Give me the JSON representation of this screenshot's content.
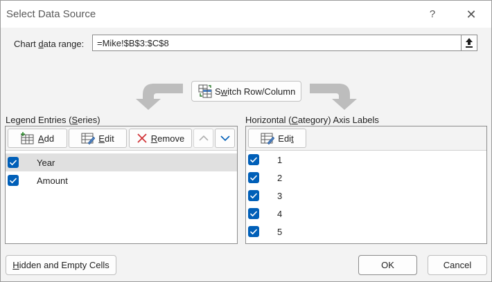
{
  "window": {
    "title": "Select Data Source",
    "help_glyph": "?",
    "close_glyph": "✕"
  },
  "range": {
    "label_pre": "Chart ",
    "label_key": "d",
    "label_post": "ata range:",
    "value": "=Mike!$B$3:$C$8"
  },
  "switch_button": {
    "label_pre": "S",
    "label_key": "w",
    "label_post": "itch Row/Column"
  },
  "legend": {
    "label_pre": "Legend Entries (",
    "label_key": "S",
    "label_post": "eries)",
    "add_key": "A",
    "add_rest": "dd",
    "edit_key": "E",
    "edit_rest": "dit",
    "remove_key": "R",
    "remove_rest": "emove",
    "items": [
      {
        "label": "Year",
        "checked": true,
        "selected": true
      },
      {
        "label": "Amount",
        "checked": true,
        "selected": false
      }
    ]
  },
  "axis": {
    "label_pre": "Horizontal (",
    "label_key": "C",
    "label_post": "ategory) Axis Labels",
    "edit_pre": "Edi",
    "edit_key": "t",
    "items": [
      {
        "label": "1",
        "checked": true
      },
      {
        "label": "2",
        "checked": true
      },
      {
        "label": "3",
        "checked": true
      },
      {
        "label": "4",
        "checked": true
      },
      {
        "label": "5",
        "checked": true
      }
    ]
  },
  "footer": {
    "hidden_key": "H",
    "hidden_rest": "idden and Empty Cells",
    "ok_label": "OK",
    "cancel_label": "Cancel"
  },
  "colors": {
    "accent": "#005fb8",
    "selected_row": "#e0e0e0",
    "dialog_bg": "#f3f3f3"
  }
}
